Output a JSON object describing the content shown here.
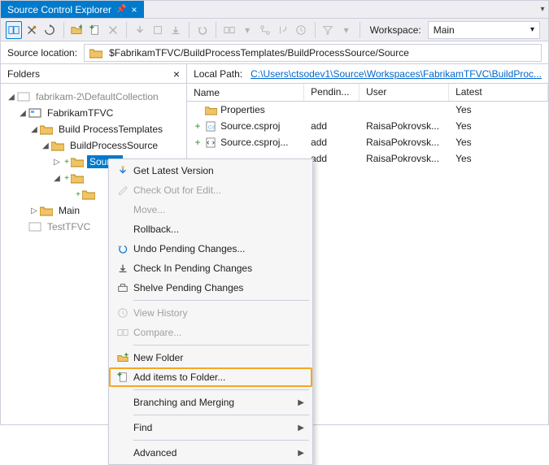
{
  "window": {
    "title": "Source Control Explorer"
  },
  "toolbar": {
    "workspace_label": "Workspace:",
    "workspace_value": "Main"
  },
  "source_location": {
    "label": "Source location:",
    "path": "$FabrikamTFVC/BuildProcessTemplates/BuildProcessSource/Source"
  },
  "folders": {
    "header": "Folders",
    "nodes": {
      "root": "fabrikam-2\\DefaultCollection",
      "proj": "FabrikamTFVC",
      "bpt": "Build ProcessTemplates",
      "bps": "BuildProcessSource",
      "src": "Source",
      "main": "Main",
      "test": "TestTFVC"
    }
  },
  "details": {
    "local_label": "Local Path:",
    "local_value": "C:\\Users\\ctsodev1\\Source\\Workspaces\\FabrikamTFVC\\BuildProc...",
    "cols": {
      "name": "Name",
      "pending": "Pendin...",
      "user": "User",
      "latest": "Latest"
    },
    "rows": [
      {
        "name": "Properties",
        "pending": "",
        "user": "",
        "latest": "Yes",
        "kind": "folder",
        "plus": ""
      },
      {
        "name": "Source.csproj",
        "pending": "add",
        "user": "RaisaPokrovsk...",
        "latest": "Yes",
        "kind": "csproj",
        "plus": "+"
      },
      {
        "name": "Source.csproj...",
        "pending": "add",
        "user": "RaisaPokrovsk...",
        "latest": "Yes",
        "kind": "file",
        "plus": "+"
      },
      {
        "name": "",
        "pending": "add",
        "user": "RaisaPokrovsk...",
        "latest": "Yes",
        "kind": "",
        "plus": ""
      }
    ]
  },
  "menu": {
    "get_latest": "Get Latest Version",
    "checkout": "Check Out for Edit...",
    "move": "Move...",
    "rollback": "Rollback...",
    "undo": "Undo Pending Changes...",
    "checkin": "Check In Pending Changes",
    "shelve": "Shelve Pending Changes",
    "history": "View History",
    "compare": "Compare...",
    "newfolder": "New Folder",
    "additems": "Add items to Folder...",
    "branching": "Branching and Merging",
    "find": "Find",
    "advanced": "Advanced"
  }
}
